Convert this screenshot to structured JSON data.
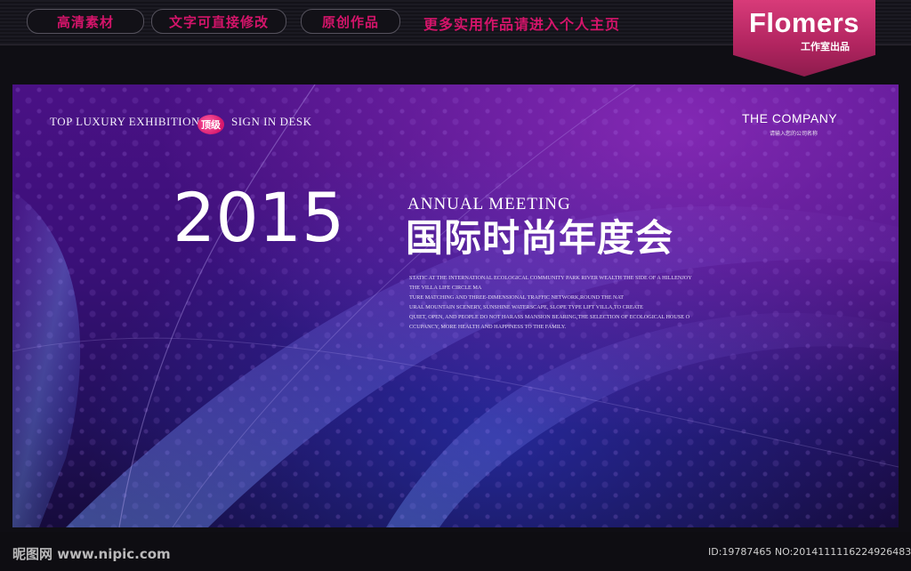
{
  "toolbar": {
    "pill_1": "高清素材",
    "pill_2": "文字可直接修改",
    "pill_3": "原创作品",
    "promo": "更多实用作品请进入个人主页"
  },
  "brand": {
    "name": "Flomers",
    "sub": "工作室出品"
  },
  "banner": {
    "subtitle_left": "TOP LUXURY EXHIBITION",
    "badge": "顶级",
    "subtitle_right": "SIGN IN DESK",
    "company_name": "THE COMPANY",
    "company_hint": "请输入您的公司名称",
    "year": "2015",
    "annual": "ANNUAL MEETING",
    "title_cn": "国际时尚年度会",
    "body_lines": [
      "STATIC AT THE INTERNATIONAL ECOLOGICAL COMMUNITY PARK RIVER WEALTH THE SIDE OF A HILLENJOY",
      "THE VILLA LIFE CIRCLE MA",
      "TURE MATCHING AND THREE-DIMENSIONAL TRAFFIC NETWORK,ROUND THE NAT",
      "URAL MOUNTAIN SCENERY, SUNSHINE WATERSCAPE, SLOPE TYPE LIFT VILLA,TO CREATE",
      "QUIET, OPEN, AND PEOPLE DO NOT HARASS MANSION BEARING,THE SELECTION OF ECOLOGICAL HOUSE O",
      "CCUPANCY, MORE HEALTH AND HAPPINESS TO THE FAMILY."
    ]
  },
  "footer": {
    "watermark": "昵图网 www.nipic.com",
    "image_id": "ID:19787465 NO:20141111162249264836"
  }
}
